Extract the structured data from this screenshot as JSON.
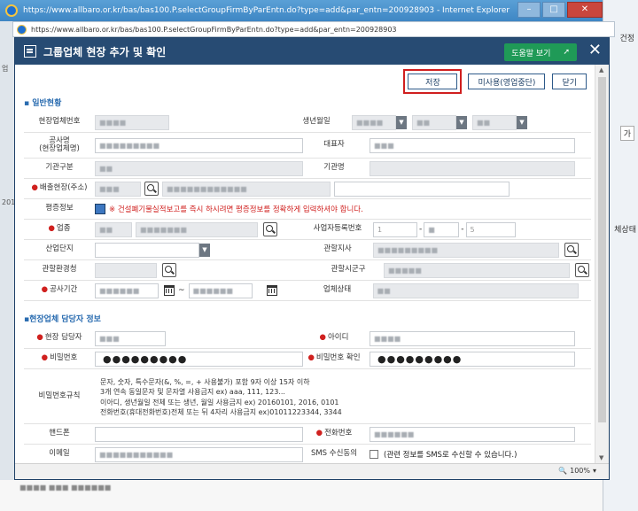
{
  "window": {
    "title": "https://www.allbaro.or.kr/bas/bas100.P.selectGroupFirmByParEntn.do?type=add&par_entn=200928903 - Internet Explorer",
    "address": "https://www.allbaro.or.kr/bas/bas100.P.selectGroupFirmByParEntn.do?type=add&par_entn=200928903",
    "min_label": "–",
    "max_label": "□",
    "close_label": "✕",
    "right_strip_labels": [
      "건정",
      "가",
      "체상태"
    ],
    "left_strip_labels": [
      "업",
      "201"
    ]
  },
  "popup": {
    "title": "그룹업체 현장 추가 및 확인",
    "help_label": "도움말 보기",
    "close_label": "✕",
    "buttons": {
      "save": "저장",
      "unused": "미사용(영업중단)",
      "close": "닫기"
    },
    "section1": "일반현황",
    "section2": "▪현장업체 담당자 정보",
    "fields": {
      "site_no": "현장업체번호",
      "birth": "생년월일",
      "company_name": "공사명\n(현장업체명)",
      "ceo": "대표자",
      "org_type": "기관구분",
      "org_name": "기관명",
      "discharge_site": "배출현장(주소)",
      "cert_info": "평증정보",
      "cert_notice": "※ 건설폐기물실적보고를 즉시 하시려면 평증정보를 정확하게 입력하셔야 합니다.",
      "business": "업종",
      "biz_reg_no": "사업자등록번호",
      "industrial_complex": "산업단지",
      "jurisdiction_branch": "관할지사",
      "env_office": "관할환경청",
      "city_county": "관할시군구",
      "construction_period": "공사기간",
      "period_sep": "~",
      "company_status": "업체상태",
      "site_manager": "현장 담당자",
      "user_id": "아이디",
      "password": "비밀번호",
      "password_confirm": "비밀번호 확인",
      "password_rules": "비밀번호규칙",
      "mobile": "핸드폰",
      "phone": "전화번호",
      "email": "이메일",
      "sms_consent": "SMS 수신동의",
      "sms_text": "(관련 정보를 SMS로 수신할 수 있습니다.)"
    },
    "password_mask": "●●●●●●●●●",
    "password_confirm_mask": "●●●●●●●●●",
    "rules_lines": [
      "문자, 숫자, 특수문자(&, %, =, + 사용불가) 포함 9자 이상 15자 이하",
      "3개 연속 동일문자 및 문자열 사용금지 ex) aaa, 111, 123...",
      "이아디, 생년월일 전체 또는 생년, 월일 사용금지 ex) 20160101, 2016, 0101",
      "전화번호(휴대전화번호)전체 또는 뒤 4자리 사용금지 ex)01011223344, 3344"
    ],
    "biz_reg_parts": [
      "1",
      "5"
    ]
  },
  "status": {
    "zoom": "100%"
  }
}
